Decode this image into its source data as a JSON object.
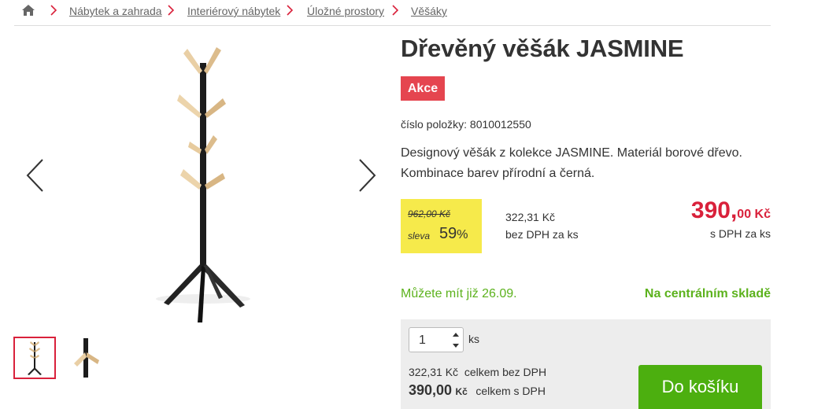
{
  "breadcrumb": {
    "home_icon": "home-icon",
    "items": [
      {
        "label": "Nábytek a zahrada"
      },
      {
        "label": "Interiérový nábytek"
      },
      {
        "label": "Úložné prostory"
      },
      {
        "label": "Věšáky"
      }
    ]
  },
  "gallery": {
    "prev_icon": "chevron-left-icon",
    "next_icon": "chevron-right-icon",
    "thumbnails_count": 2
  },
  "product": {
    "title": "Dřevěný věšák JASMINE",
    "badge": "Akce",
    "sku": "číslo položky: 8010012550",
    "description": "Designový věšák z kolekce JASMINE. Materiál borové dřevo. Kombinace barev přírodní a černá."
  },
  "price": {
    "old": "962,00 Kč",
    "discount_label": "sleva",
    "discount_value": "59",
    "discount_unit": "%",
    "net": "322,31 Kč",
    "net_note": "bez DPH za ks",
    "gross_main": "390,",
    "gross_decimals": "00 Kč",
    "gross_note": "s DPH za ks"
  },
  "availability": {
    "date": "Můžete mít již 26.09.",
    "stock": "Na centrálním skladě"
  },
  "cart": {
    "quantity": "1",
    "unit": "ks",
    "total_net_value": "322,31 Kč",
    "total_net_note": "celkem bez DPH",
    "total_gross_value": "390,00",
    "total_gross_currency": "Kč",
    "total_gross_note": "celkem s DPH",
    "button": "Do košíku"
  },
  "colors": {
    "accent_red": "#d9213b",
    "badge_red": "#e5454f",
    "green": "#5cb21d",
    "button_green": "#4caf0f",
    "discount_yellow": "#f6ea4b"
  }
}
